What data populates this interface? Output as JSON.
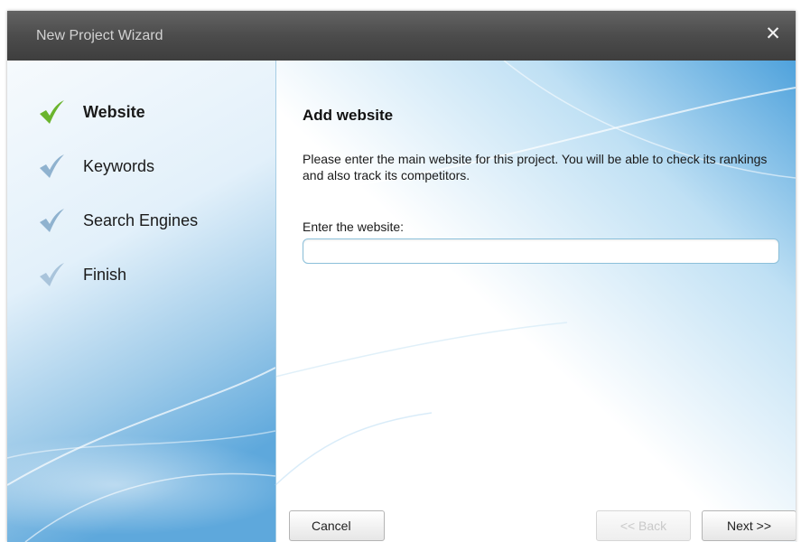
{
  "window": {
    "title": "New Project Wizard",
    "close_label": "✕"
  },
  "steps": [
    {
      "label": "Website",
      "state": "active",
      "check_color": "#6ab42d"
    },
    {
      "label": "Keywords",
      "state": "pending",
      "check_color": "#8fb2cf"
    },
    {
      "label": "Search Engines",
      "state": "pending",
      "check_color": "#8fb2cf"
    },
    {
      "label": "Finish",
      "state": "pending",
      "check_color": "#a9c4db"
    }
  ],
  "main": {
    "heading": "Add website",
    "description": "Please enter the main website for this project. You will be able to check its rankings and also track its competitors.",
    "field_label": "Enter the website:",
    "website_value": "",
    "website_placeholder": ""
  },
  "buttons": {
    "cancel": "Cancel",
    "back": "<< Back",
    "next": "Next >>"
  }
}
